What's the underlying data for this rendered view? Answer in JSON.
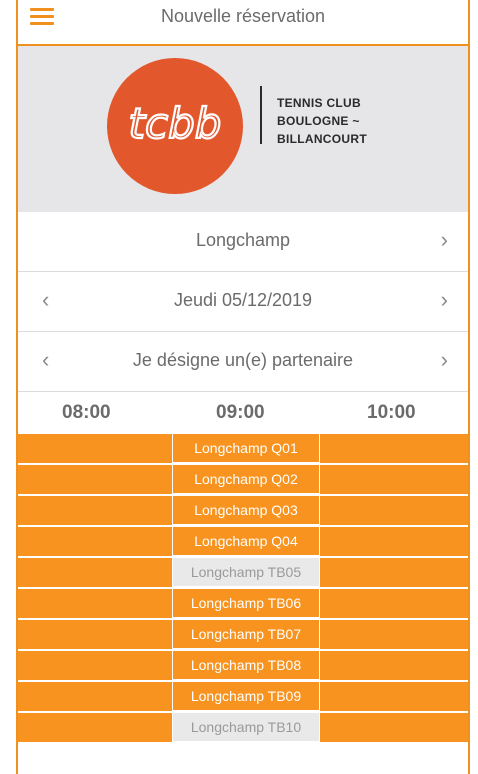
{
  "header": {
    "title": "Nouvelle réservation"
  },
  "banner": {
    "logo_text": "tcbb",
    "club_lines": [
      "TENNIS CLUB",
      "BOULOGNE ~",
      "BILLANCOURT"
    ],
    "logo_color": "#e2572c"
  },
  "location": {
    "label": "Longchamp"
  },
  "date": {
    "label": "Jeudi 05/12/2019"
  },
  "partner": {
    "label": "Je désigne un(e) partenaire"
  },
  "times": [
    "08:00",
    "09:00",
    "10:00"
  ],
  "courts": [
    {
      "name": "Longchamp Q01",
      "available": true
    },
    {
      "name": "Longchamp Q02",
      "available": true
    },
    {
      "name": "Longchamp Q03",
      "available": true
    },
    {
      "name": "Longchamp Q04",
      "available": true
    },
    {
      "name": "Longchamp TB05",
      "available": false
    },
    {
      "name": "Longchamp TB06",
      "available": true
    },
    {
      "name": "Longchamp TB07",
      "available": true
    },
    {
      "name": "Longchamp TB08",
      "available": true
    },
    {
      "name": "Longchamp TB09",
      "available": true
    },
    {
      "name": "Longchamp TB10",
      "available": false
    }
  ],
  "colors": {
    "accent": "#f7931e",
    "unavailable": "#e9e9ea"
  }
}
